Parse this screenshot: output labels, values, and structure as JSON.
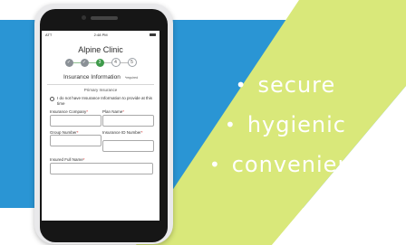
{
  "status_bar": {
    "carrier": "ATT",
    "time": "2:48 PM",
    "battery": ""
  },
  "clinic_name": "Alpine Clinic",
  "steps": [
    {
      "label": "✓",
      "state": "done"
    },
    {
      "label": "✓",
      "state": "done"
    },
    {
      "label": "3",
      "state": "active"
    },
    {
      "label": "4",
      "state": "todo"
    },
    {
      "label": "5",
      "state": "todo"
    }
  ],
  "section": {
    "title": "Insurance Information",
    "required_note": "*required",
    "subtitle": "Primary Insurance"
  },
  "no_insurance_option": "I do not have Insurance Information to provide at this time",
  "fields": {
    "insurance_company": "Insurance Company",
    "plan_name": "Plan Name",
    "group_number": "Group Number",
    "insurance_id": "Insurance ID Number",
    "insured_full_name": "Insured Full Name"
  },
  "required_mark": "*",
  "bullets": [
    "secure",
    "hygienic",
    "convenient"
  ],
  "bullet_symbol": "•",
  "colors": {
    "blue": "#2a95d4",
    "lime": "#d9e87a",
    "active_step": "#3e9a4a"
  }
}
